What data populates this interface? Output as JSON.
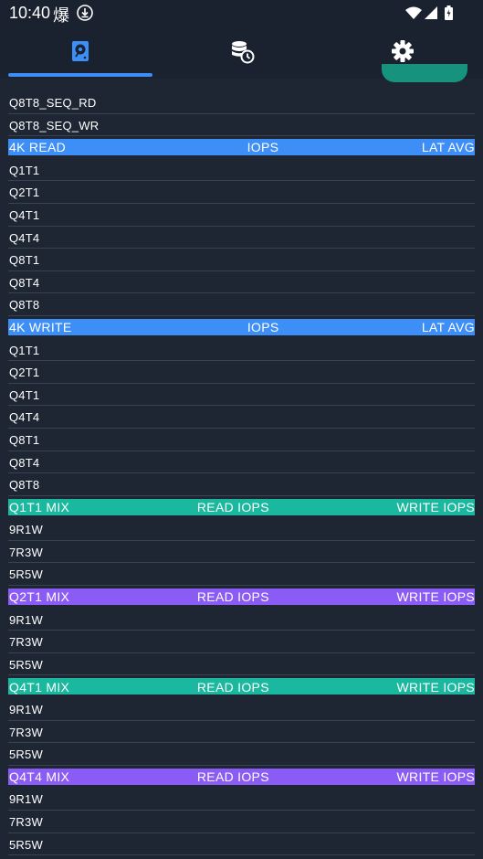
{
  "status_bar": {
    "time": "10:40",
    "app_glyph": "爆",
    "icons": [
      "download-status-icon",
      "wifi-icon",
      "signal-icon",
      "battery-icon"
    ]
  },
  "tabs": [
    {
      "icon": "disk-icon",
      "selected": true
    },
    {
      "icon": "database-history-icon",
      "selected": false
    },
    {
      "icon": "gear-icon",
      "selected": false
    }
  ],
  "colors": {
    "background": "#1f2633",
    "blue_header": "#3d8ef6",
    "teal_header": "#1ab89f",
    "purple_header": "#8a5cf5",
    "fab": "#17927d"
  },
  "seq_rows": [
    "Q8T8_SEQ_RD",
    "Q8T8_SEQ_WR"
  ],
  "read_section": {
    "header": [
      "4K READ",
      "IOPS",
      "LAT AVG"
    ],
    "rows": [
      "Q1T1",
      "Q2T1",
      "Q4T1",
      "Q4T4",
      "Q8T1",
      "Q8T4",
      "Q8T8"
    ]
  },
  "write_section": {
    "header": [
      "4K WRITE",
      "IOPS",
      "LAT AVG"
    ],
    "rows": [
      "Q1T1",
      "Q2T1",
      "Q4T1",
      "Q4T4",
      "Q8T1",
      "Q8T4",
      "Q8T8"
    ]
  },
  "mix_sections": [
    {
      "header": [
        "Q1T1 MIX",
        "READ IOPS",
        "WRITE IOPS"
      ],
      "rows": [
        "9R1W",
        "7R3W",
        "5R5W"
      ]
    },
    {
      "header": [
        "Q2T1 MIX",
        "READ IOPS",
        "WRITE IOPS"
      ],
      "rows": [
        "9R1W",
        "7R3W",
        "5R5W"
      ]
    },
    {
      "header": [
        "Q4T1 MIX",
        "READ IOPS",
        "WRITE IOPS"
      ],
      "rows": [
        "9R1W",
        "7R3W",
        "5R5W"
      ]
    },
    {
      "header": [
        "Q4T4 MIX",
        "READ IOPS",
        "WRITE IOPS"
      ],
      "rows": [
        "9R1W",
        "7R3W",
        "5R5W"
      ]
    }
  ]
}
